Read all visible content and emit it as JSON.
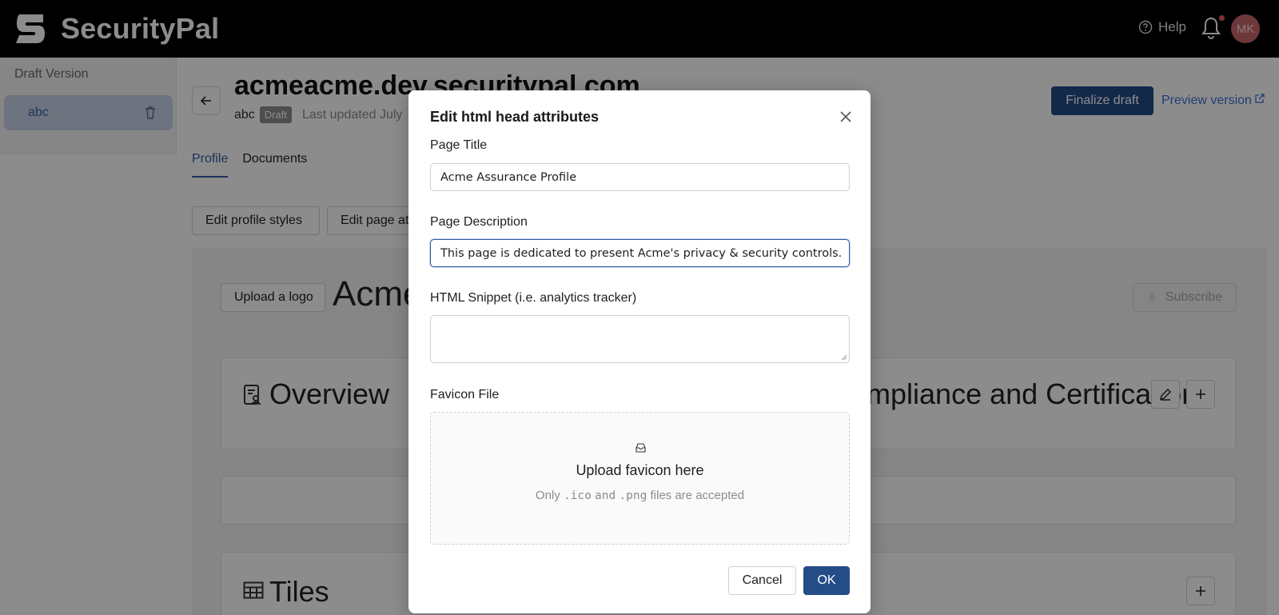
{
  "header": {
    "brand_name": "SecurityPal",
    "help_label": "Help",
    "avatar_initials": "MK"
  },
  "sidebar": {
    "title": "Draft Version",
    "items": [
      {
        "label": "abc"
      }
    ]
  },
  "page": {
    "title": "acmeacme.dev.securitypal.com",
    "subtitle_name": "abc",
    "status_badge": "Draft",
    "last_updated": "Last updated July",
    "finalize_label": "Finalize draft",
    "preview_label": "Preview version"
  },
  "tabs": [
    {
      "label": "Profile",
      "active": true
    },
    {
      "label": "Documents",
      "active": false
    }
  ],
  "toolbar": {
    "edit_styles_label": "Edit profile styles",
    "edit_page_label": "Edit page attributes"
  },
  "profile": {
    "upload_logo_label": "Upload a logo",
    "company_name": "Acme",
    "subscribe_label": "Subscribe",
    "overview_title": "Overview",
    "compliance_title": "Compliance and Certifications",
    "tiles_title": "Tiles"
  },
  "modal": {
    "title": "Edit html head attributes",
    "page_title_label": "Page Title",
    "page_title_value": "Acme Assurance Profile",
    "page_description_label": "Page Description",
    "page_description_value": "This page is dedicated to present Acme's privacy & security controls.",
    "snippet_label": "HTML Snippet (i.e. analytics tracker)",
    "snippet_value": "",
    "favicon_label": "Favicon File",
    "upload_title": "Upload favicon here",
    "hint_prefix": "Only",
    "hint_ext1": ".ico",
    "hint_and": "and",
    "hint_ext2": ".png",
    "hint_suffix": "files are accepted",
    "cancel_label": "Cancel",
    "ok_label": "OK"
  },
  "colors": {
    "primary": "#244c87",
    "link": "#3f6ed3",
    "topbar": "#000000",
    "notification_dot": "#e85a5a",
    "avatar": "#c9676b"
  }
}
